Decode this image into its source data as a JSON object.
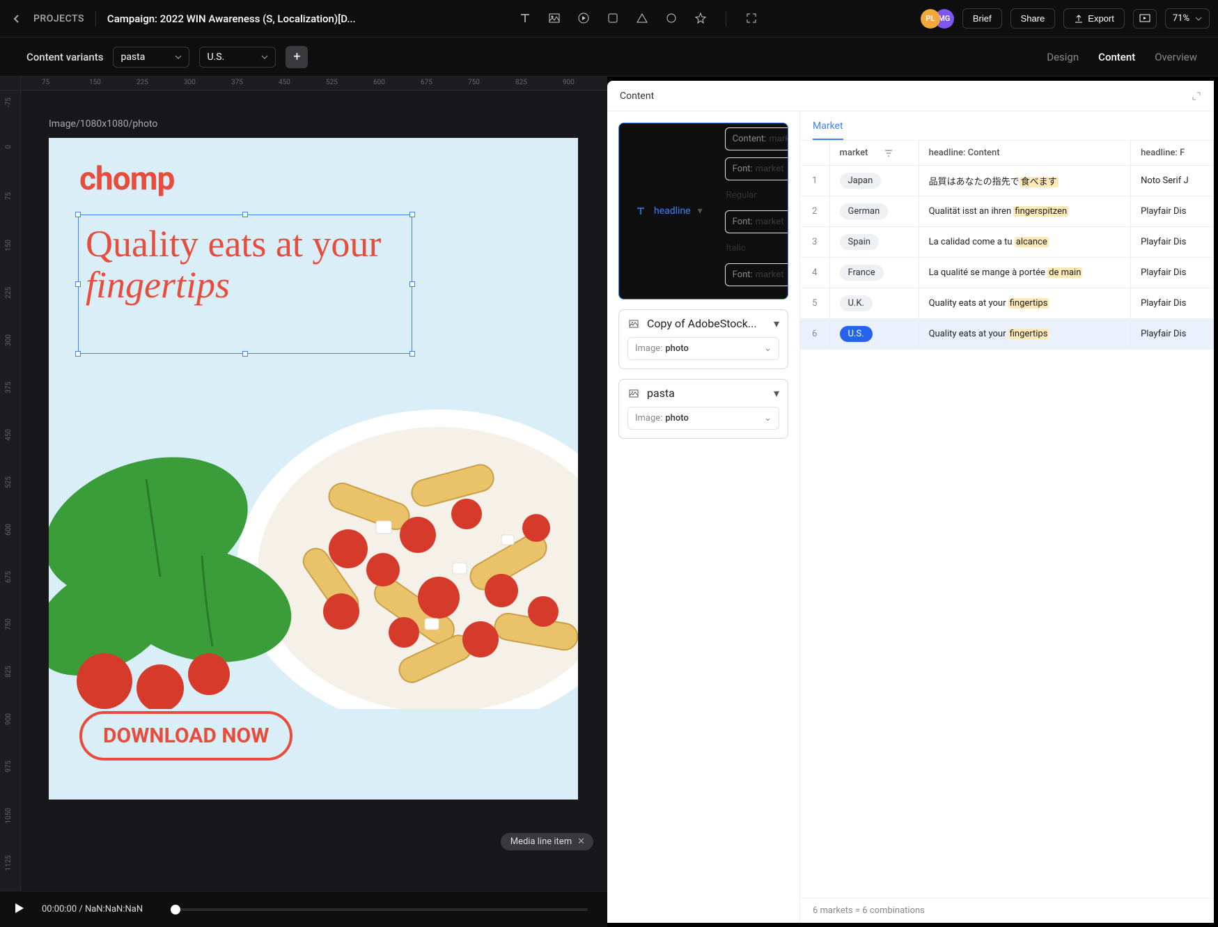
{
  "header": {
    "back_label": "PROJECTS",
    "title": "Campaign: 2022 WIN Awareness (S, Localization)[D...",
    "avatars": [
      "PL",
      "MG"
    ],
    "brief_btn": "Brief",
    "share_btn": "Share",
    "export_btn": "Export",
    "zoom": "71%"
  },
  "subbar": {
    "label": "Content variants",
    "variant_sel": "pasta",
    "market_sel": "U.S.",
    "tabs": {
      "design": "Design",
      "content": "Content",
      "overview": "Overview"
    }
  },
  "ruler_h": [
    "75",
    "150",
    "225",
    "300",
    "375",
    "450",
    "525",
    "600",
    "675",
    "750",
    "825",
    "900"
  ],
  "ruler_v": [
    "-75",
    "0",
    "75",
    "150",
    "225",
    "300",
    "375",
    "450",
    "525",
    "600",
    "675",
    "750",
    "825",
    "900",
    "975",
    "1050",
    "1125"
  ],
  "canvas": {
    "asset_label": "Image/1080x1080/photo",
    "logo": "chomp",
    "headline_plain": "Quality eats at your ",
    "headline_italic": "fingertips",
    "cta": "DOWNLOAD NOW",
    "chip": "Media line item"
  },
  "timeline": {
    "time": "00:00:00 / NaN:NaN:NaN"
  },
  "panel": {
    "title": "Content",
    "tab": "Market",
    "footer": "6 markets = 6 combinations",
    "layers": {
      "headline": {
        "name": "headline",
        "content_label": "Content:",
        "content_val": "market",
        "font_label": "Font:",
        "font_val": "market",
        "regular": "Regular",
        "italic": "Italic"
      },
      "adobe": {
        "name": "Copy of AdobeStock...",
        "image_label": "Image:",
        "image_val": "photo"
      },
      "pasta": {
        "name": "pasta",
        "image_label": "Image:",
        "image_val": "photo"
      }
    },
    "columns": {
      "market": "market",
      "content": "headline: Content",
      "font": "headline: F"
    },
    "rows": [
      {
        "n": "1",
        "market": "Japan",
        "content_pre": "品質はあなたの指先で",
        "content_hl": "食べます",
        "content_post": "",
        "font": "Noto Serif J"
      },
      {
        "n": "2",
        "market": "German",
        "content_pre": "Qualität isst an ihren ",
        "content_hl": "fingerspitzen",
        "content_post": "",
        "font": "Playfair Dis"
      },
      {
        "n": "3",
        "market": "Spain",
        "content_pre": "La calidad come a tu ",
        "content_hl": "alcance",
        "content_post": "",
        "font": "Playfair Dis"
      },
      {
        "n": "4",
        "market": "France",
        "content_pre": "La qualité se mange à portée ",
        "content_hl": "de main",
        "content_post": "",
        "font": "Playfair Dis"
      },
      {
        "n": "5",
        "market": "U.K.",
        "content_pre": "Quality eats at your ",
        "content_hl": "fingertips",
        "content_post": "",
        "font": "Playfair Dis"
      },
      {
        "n": "6",
        "market": "U.S.",
        "content_pre": "Quality eats at your ",
        "content_hl": "fingertips",
        "content_post": "",
        "font": "Playfair Dis",
        "active": true
      }
    ]
  }
}
